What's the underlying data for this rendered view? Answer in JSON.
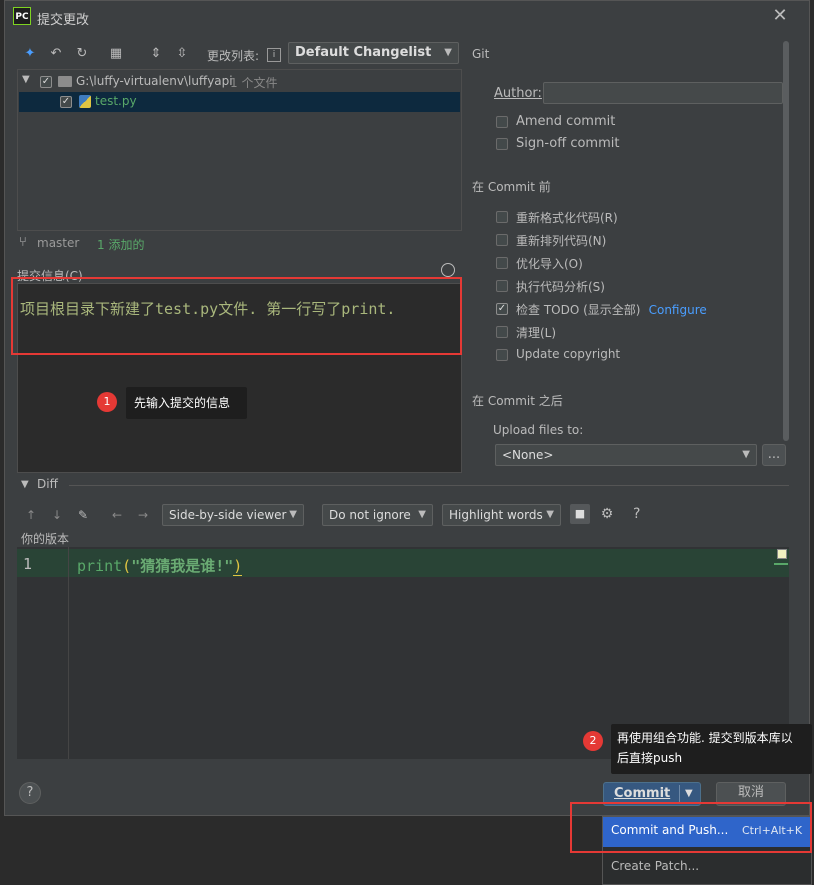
{
  "window": {
    "app_badge": "PC",
    "title": "提交更改"
  },
  "toolbar": {
    "changelist_label": "更改列表:",
    "changelist_value": "Default Changelist"
  },
  "tree": {
    "root_path": "G:\\luffy-virtualenv\\luffyapi",
    "root_count": "1 个文件",
    "file_name": "test.py"
  },
  "branch": {
    "name": "master",
    "status": "1 添加的"
  },
  "commit_message": {
    "label": "提交信息(C)",
    "text": "项目根目录下新建了test.py文件. 第一行写了print."
  },
  "annotations": {
    "note1_num": "1",
    "note1_text": "先输入提交的信息",
    "note2_num": "2",
    "note2_line1": "再使用组合功能. 提交到版本库以",
    "note2_line2": "后直接push"
  },
  "git": {
    "section": "Git",
    "author_label": "Author:",
    "author_value": "",
    "amend": "Amend commit",
    "signoff": "Sign-off commit"
  },
  "before_commit": {
    "section": "在 Commit 前",
    "items": [
      {
        "label": "重新格式化代码(R)",
        "checked": false
      },
      {
        "label": "重新排列代码(N)",
        "checked": false
      },
      {
        "label": "优化导入(O)",
        "checked": false
      },
      {
        "label": "执行代码分析(S)",
        "checked": false
      },
      {
        "label": "检查 TODO (显示全部)",
        "checked": true,
        "link": "Configure"
      },
      {
        "label": "清理(L)",
        "checked": false
      },
      {
        "label": "Update copyright",
        "checked": false
      }
    ]
  },
  "after_commit": {
    "section": "在 Commit 之后",
    "upload_label": "Upload files to:",
    "upload_value": "<None>",
    "browse": "..."
  },
  "diff": {
    "header": "Diff",
    "viewer": "Side-by-side viewer",
    "ignore": "Do not ignore",
    "highlight": "Highlight words",
    "help": "?",
    "version_label": "你的版本",
    "line_number": "1",
    "code_func": "print",
    "code_open": "(",
    "code_string": "\"猜猜我是谁!\"",
    "code_close": ")"
  },
  "footer": {
    "help": "?",
    "commit": "Commit",
    "cancel": "取消"
  },
  "dropdown_menu": {
    "commit_push": "Commit and Push...",
    "commit_push_shortcut": "Ctrl+Alt+K",
    "create_patch": "Create Patch..."
  },
  "colors": {
    "accent_blue": "#4a9eff",
    "annotation_red": "#e53935",
    "added_green_bg": "#294436",
    "menu_selected": "#2f65ca"
  }
}
